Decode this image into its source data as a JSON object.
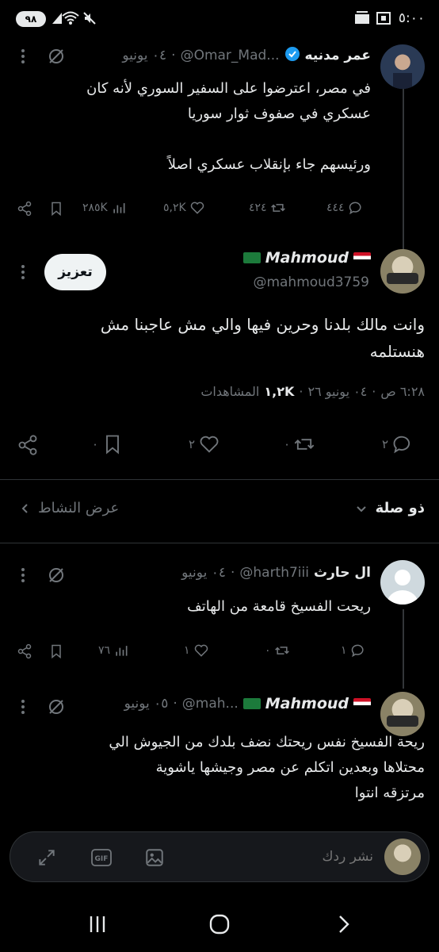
{
  "status_bar": {
    "time": "٥:٠٠",
    "battery": "٩٨"
  },
  "tweet1": {
    "display_name": "عمر مدنيه",
    "handle": "@Omar_Mad...",
    "date": "٠٤ يونيو",
    "text_line1": "في مصر، اعترضوا على السفير السوري لأنه كان",
    "text_line2": "عسكري في صفوف ثوار سوريا",
    "text_line3": "ورئيسهم جاء بإنقلاب عسكري اصلاً",
    "replies": "٤٤٤",
    "retweets": "٤٢٤",
    "likes": "٥,٢K",
    "views": "٢٨٥K"
  },
  "main_tweet": {
    "display_name": "Mahmoud",
    "handle": "@mahmoud3759",
    "boost_label": "تعزيز",
    "text_line1": "وانت مالك بلدنا وحرين فيها والي مش عاجبنا مش",
    "text_line2": "هنستلمه",
    "time": "٦:٢٨ ص",
    "date": "٠٤ يونيو ٢٦",
    "views_count": "١,٢K",
    "views_label": "المشاهدات",
    "replies": "٢",
    "retweets": "٠",
    "likes": "٢",
    "bookmarks": "٠"
  },
  "sort_bar": {
    "relevance": "ذو صلة",
    "activity": "عرض النشاط"
  },
  "reply1": {
    "display_name": "ال حارث",
    "handle": "@harth7iii",
    "date": "٠٤ يونيو",
    "text": "ريحت الفسيخ قامعة من الهاتف",
    "replies": "١",
    "retweets": "٠",
    "likes": "١",
    "views": "٧٦"
  },
  "reply2": {
    "display_name": "Mahmoud",
    "handle": "@mah...",
    "date": "٠٥ يونيو",
    "text_line1": "ريحة الفسيخ نفس ريحتك نضف بلدك من الجيوش الي",
    "text_line2": "محتلاها وبعدين اتكلم عن مصر وجيشها ياشوية",
    "text_line3": "مرتزقه انتوا"
  },
  "composer": {
    "placeholder": "نشر ردك"
  },
  "colors": {
    "background": "#000000",
    "text": "#e7e9ea",
    "muted": "#71767b",
    "verified": "#1d9bf0",
    "divider": "#2f3336"
  }
}
